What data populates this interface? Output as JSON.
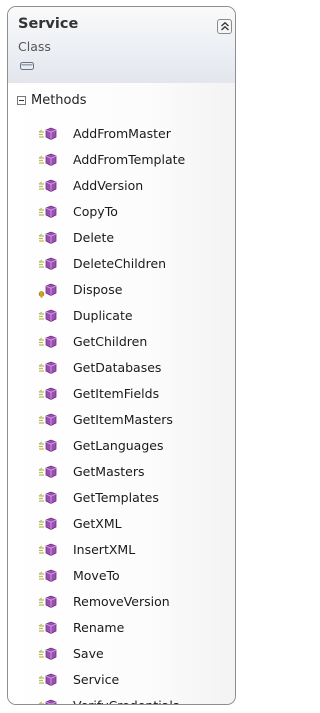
{
  "class": {
    "name": "Service",
    "kind": "Class"
  },
  "section": {
    "label": "Methods"
  },
  "methods": [
    {
      "name": "AddFromMaster",
      "icon": "public-method-icon"
    },
    {
      "name": "AddFromTemplate",
      "icon": "public-method-icon"
    },
    {
      "name": "AddVersion",
      "icon": "public-method-icon"
    },
    {
      "name": "CopyTo",
      "icon": "public-method-icon"
    },
    {
      "name": "Delete",
      "icon": "public-method-icon"
    },
    {
      "name": "DeleteChildren",
      "icon": "public-method-icon"
    },
    {
      "name": "Dispose",
      "icon": "interface-method-icon"
    },
    {
      "name": "Duplicate",
      "icon": "public-method-icon"
    },
    {
      "name": "GetChildren",
      "icon": "public-method-icon"
    },
    {
      "name": "GetDatabases",
      "icon": "public-method-icon"
    },
    {
      "name": "GetItemFields",
      "icon": "public-method-icon"
    },
    {
      "name": "GetItemMasters",
      "icon": "public-method-icon"
    },
    {
      "name": "GetLanguages",
      "icon": "public-method-icon"
    },
    {
      "name": "GetMasters",
      "icon": "public-method-icon"
    },
    {
      "name": "GetTemplates",
      "icon": "public-method-icon"
    },
    {
      "name": "GetXML",
      "icon": "public-method-icon"
    },
    {
      "name": "InsertXML",
      "icon": "public-method-icon"
    },
    {
      "name": "MoveTo",
      "icon": "public-method-icon"
    },
    {
      "name": "RemoveVersion",
      "icon": "public-method-icon"
    },
    {
      "name": "Rename",
      "icon": "public-method-icon"
    },
    {
      "name": "Save",
      "icon": "public-method-icon"
    },
    {
      "name": "Service",
      "icon": "public-method-icon"
    },
    {
      "name": "VerifyCredentials",
      "icon": "public-method-icon"
    }
  ],
  "colors": {
    "method_icon": "#9b4fb0",
    "method_lines": "#b9b957",
    "interface_key": "#d4a21c"
  }
}
